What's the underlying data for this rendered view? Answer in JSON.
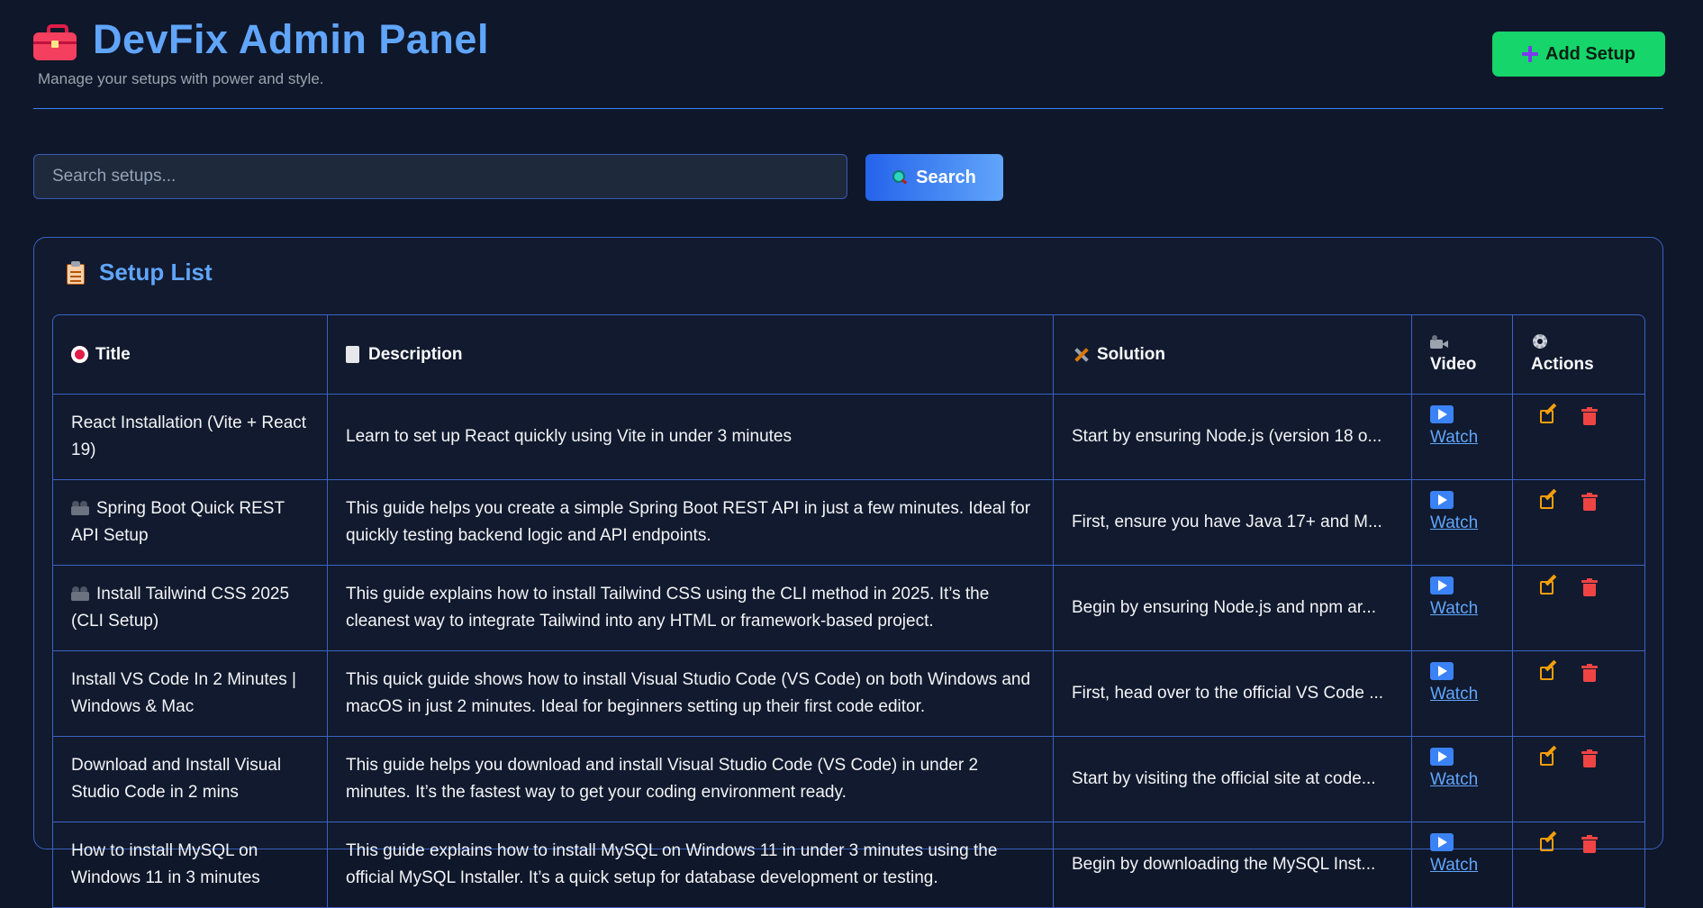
{
  "header": {
    "title": "DevFix Admin Panel",
    "subtitle": "Manage your setups with power and style.",
    "add_button_label": "Add Setup"
  },
  "search": {
    "placeholder": "Search setups...",
    "value": "",
    "button_label": "Search"
  },
  "panel": {
    "title": "Setup List"
  },
  "table": {
    "headers": {
      "title": "Title",
      "description": "Description",
      "solution": "Solution",
      "video": "Video",
      "actions": "Actions"
    },
    "watch_label": "Watch",
    "rows": [
      {
        "title": "React Installation (Vite + React 19)",
        "description": "Learn to set up React quickly using Vite in under 3 minutes",
        "solution": "Start by ensuring Node.js (version 18 o..."
      },
      {
        "title": "Spring Boot Quick REST API Setup",
        "description": "This guide helps you create a simple Spring Boot REST API in just a few minutes. Ideal for quickly testing backend logic and API endpoints.",
        "solution": "First, ensure you have Java 17+ and M..."
      },
      {
        "title": "Install Tailwind CSS 2025 (CLI Setup)",
        "description": "This guide explains how to install Tailwind CSS using the CLI method in 2025. It’s the cleanest way to integrate Tailwind into any HTML or framework-based project.",
        "solution": "Begin by ensuring Node.js and npm ar..."
      },
      {
        "title": "Install VS Code In 2 Minutes | Windows & Mac",
        "description": "This quick guide shows how to install Visual Studio Code (VS Code) on both Windows and macOS in just 2 minutes. Ideal for beginners setting up their first code editor.",
        "solution": "First, head over to the official VS Code ..."
      },
      {
        "title": "Download and Install Visual Studio Code in 2 mins",
        "description": "This guide helps you download and install Visual Studio Code (VS Code) in under 2 minutes. It’s the fastest way to get your coding environment ready.",
        "solution": "Start by visiting the official site at code..."
      },
      {
        "title": "How to install MySQL on Windows 11 in 3 minutes",
        "description": "This guide explains how to install MySQL on Windows 11 in under 3 minutes using the official MySQL Installer. It’s a quick setup for database development or testing.",
        "solution": "Begin by downloading the MySQL Inst..."
      }
    ]
  }
}
